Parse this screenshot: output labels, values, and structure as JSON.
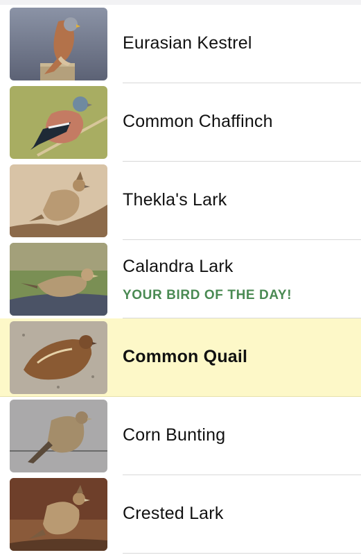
{
  "birds": [
    {
      "name": "Eurasian Kestrel"
    },
    {
      "name": "Common Chaffinch"
    },
    {
      "name": "Thekla's Lark"
    },
    {
      "name": "Calandra Lark",
      "subtitle": "YOUR BIRD OF THE DAY!"
    },
    {
      "name": "Common Quail",
      "selected": true
    },
    {
      "name": "Corn Bunting"
    },
    {
      "name": "Crested Lark"
    }
  ],
  "colors": {
    "highlight": "#fdf8c8",
    "subtitle": "#4a8a53"
  }
}
